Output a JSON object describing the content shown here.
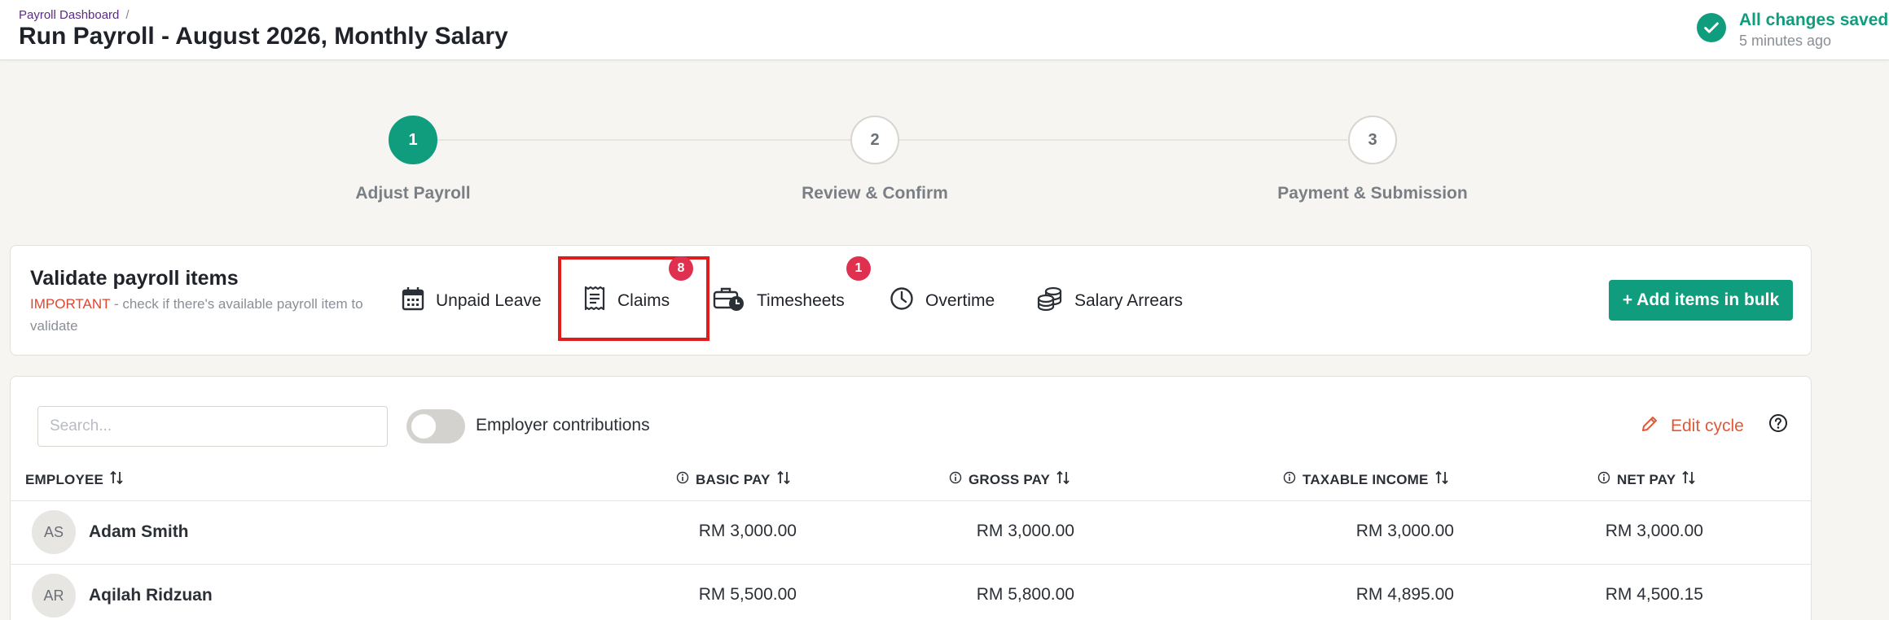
{
  "header": {
    "breadcrumb": "Payroll Dashboard",
    "breadcrumb_sep": "/",
    "title": "Run Payroll - August 2026, Monthly Salary",
    "save_status": "All changes saved",
    "save_time": "5 minutes ago"
  },
  "stepper": {
    "steps": [
      {
        "number": "1",
        "label": "Adjust Payroll",
        "active": true
      },
      {
        "number": "2",
        "label": "Review & Confirm",
        "active": false
      },
      {
        "number": "3",
        "label": "Payment & Submission",
        "active": false
      }
    ]
  },
  "validate": {
    "title": "Validate payroll items",
    "important": "IMPORTANT",
    "note": " - check if there's available payroll item to validate",
    "tabs": [
      {
        "label": "Unpaid Leave",
        "icon": "calendar-icon"
      },
      {
        "label": "Claims",
        "icon": "receipt-icon",
        "badge": "8"
      },
      {
        "label": "Timesheets",
        "icon": "briefcase-clock-icon",
        "badge": "1"
      },
      {
        "label": "Overtime",
        "icon": "clock-icon"
      },
      {
        "label": "Salary Arrears",
        "icon": "coins-icon"
      }
    ],
    "bulk_button": "+ Add items in bulk"
  },
  "table": {
    "search_placeholder": "Search...",
    "toggle_label": "Employer contributions",
    "edit_cycle": "Edit cycle",
    "columns": [
      "EMPLOYEE",
      "BASIC PAY",
      "GROSS PAY",
      "TAXABLE INCOME",
      "NET PAY"
    ],
    "rows": [
      {
        "initials": "AS",
        "name": "Adam Smith",
        "basic": "RM 3,000.00",
        "gross": "RM 3,000.00",
        "taxable": "RM 3,000.00",
        "net": "RM 3,000.00"
      },
      {
        "initials": "AR",
        "name": "Aqilah Ridzuan",
        "basic": "RM 5,500.00",
        "gross": "RM 5,800.00",
        "taxable": "RM 4,895.00",
        "net": "RM 4,500.15"
      }
    ]
  },
  "colors": {
    "accent": "#0f9d7e",
    "badge": "#e0304f",
    "important": "#e0452f",
    "highlight": "#e01b1b"
  }
}
